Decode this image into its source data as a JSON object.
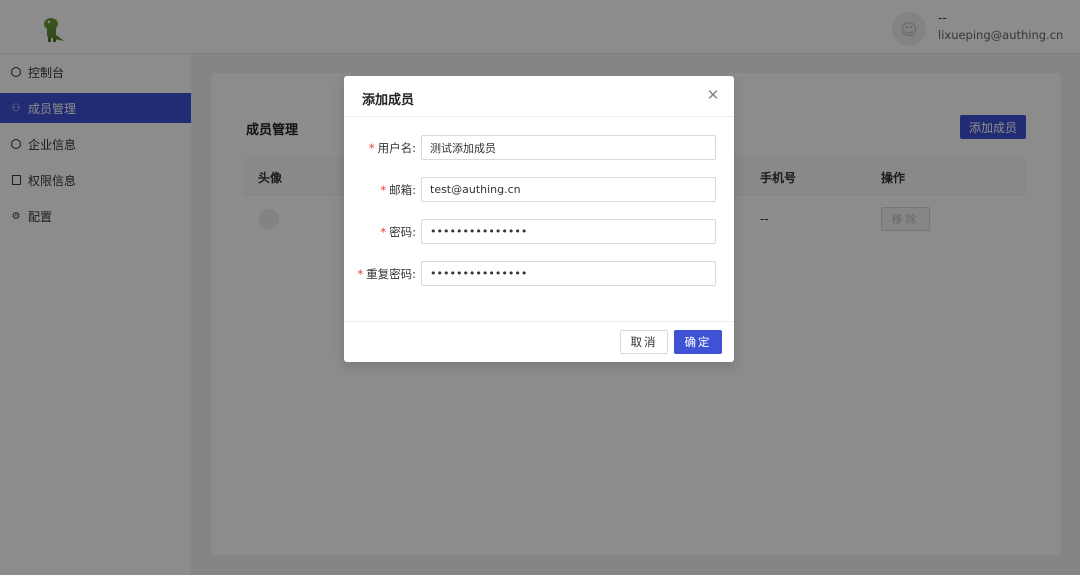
{
  "header": {
    "user_name": "--",
    "user_email": "lixueping@authing.cn"
  },
  "sidebar": {
    "items": [
      {
        "label": "控制台",
        "icon": "dashboard-icon"
      },
      {
        "label": "成员管理",
        "icon": "team-icon",
        "active": true
      },
      {
        "label": "企业信息",
        "icon": "info-icon"
      },
      {
        "label": "权限信息",
        "icon": "permission-icon"
      },
      {
        "label": "配置",
        "icon": "gear-icon"
      }
    ]
  },
  "main": {
    "title": "成员管理",
    "add_button": "添加成员",
    "table": {
      "columns": {
        "avatar": "头像",
        "phone": "手机号",
        "action": "操作"
      },
      "rows": [
        {
          "phone": "--",
          "action": "移除"
        }
      ]
    }
  },
  "modal": {
    "title": "添加成员",
    "fields": {
      "username": {
        "label": "用户名:",
        "value": "测试添加成员"
      },
      "email": {
        "label": "邮箱:",
        "value": "test@authing.cn"
      },
      "password": {
        "label": "密码:",
        "value": "•••••••••••••••"
      },
      "confirm": {
        "label": "重复密码:",
        "value": "•••••••••••••••"
      }
    },
    "cancel": "取消",
    "ok": "确定"
  },
  "colors": {
    "accent": "#3f51d4",
    "required": "#e53935"
  }
}
